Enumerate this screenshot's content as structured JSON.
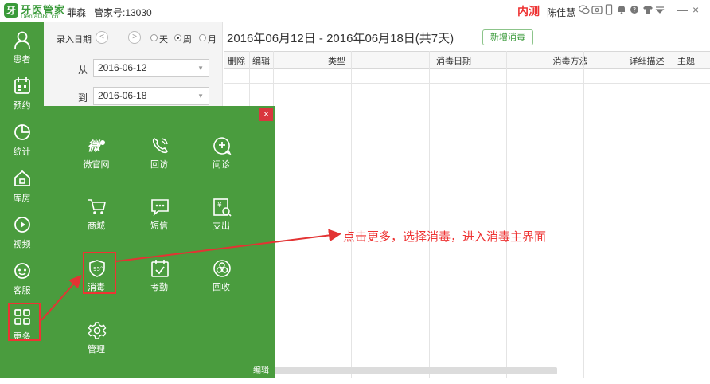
{
  "titlebar": {
    "logo_mark": "牙",
    "logo_name": "牙医管家",
    "logo_url": "Dental360.cn",
    "user_name": "菲森",
    "butler_no": "管家号:13030",
    "internal_test": "内测",
    "current_user": "陈佳慧",
    "icons": [
      "wechat-icon",
      "phone-icon",
      "mobile-icon",
      "bell-icon",
      "help-icon",
      "tshirt-icon",
      "dropdown-icon"
    ],
    "minimize": "—",
    "close": "×"
  },
  "sidebar": {
    "items": [
      {
        "label": "患者",
        "icon": "user-icon"
      },
      {
        "label": "预约",
        "icon": "calendar-icon"
      },
      {
        "label": "统计",
        "icon": "pie-chart-icon"
      },
      {
        "label": "库房",
        "icon": "warehouse-icon"
      },
      {
        "label": "视频",
        "icon": "play-icon"
      },
      {
        "label": "客服",
        "icon": "customer-service-icon"
      },
      {
        "label": "更多",
        "icon": "grid-icon"
      }
    ]
  },
  "filter": {
    "entry_date_label": "录入日期",
    "prev": "<",
    "next": ">",
    "period_options": [
      "天",
      "周",
      "月"
    ],
    "selected_period": "周",
    "from_label": "从",
    "from_date": "2016-06-12",
    "to_label": "到",
    "to_date": "2016-06-18"
  },
  "main": {
    "range_title": "2016年06月12日 - 2016年06月18日(共7天)",
    "add_button": "新增消毒",
    "columns": [
      "删除",
      "编辑",
      "类型",
      "消毒日期",
      "消毒方法",
      "主题",
      "详细描述"
    ]
  },
  "more_panel": {
    "close": "×",
    "tiles": [
      {
        "label": "微官网",
        "icon": "weibo-icon"
      },
      {
        "label": "回访",
        "icon": "phone-call-icon"
      },
      {
        "label": "问诊",
        "icon": "consult-icon"
      },
      {
        "label": "商城",
        "icon": "cart-icon"
      },
      {
        "label": "短信",
        "icon": "sms-icon"
      },
      {
        "label": "支出",
        "icon": "expense-icon"
      },
      {
        "label": "消毒",
        "icon": "disinfect-icon"
      },
      {
        "label": "考勤",
        "icon": "attendance-icon"
      },
      {
        "label": "回收",
        "icon": "biohazard-icon"
      },
      {
        "label": "管理",
        "icon": "settings-icon"
      }
    ],
    "edit": "编辑"
  },
  "annotation": {
    "text": "点击更多，选择消毒，进入消毒主界面",
    "color": "#e33333"
  },
  "colors": {
    "brand_green": "#4a9c3e",
    "accent_red": "#e33333"
  }
}
